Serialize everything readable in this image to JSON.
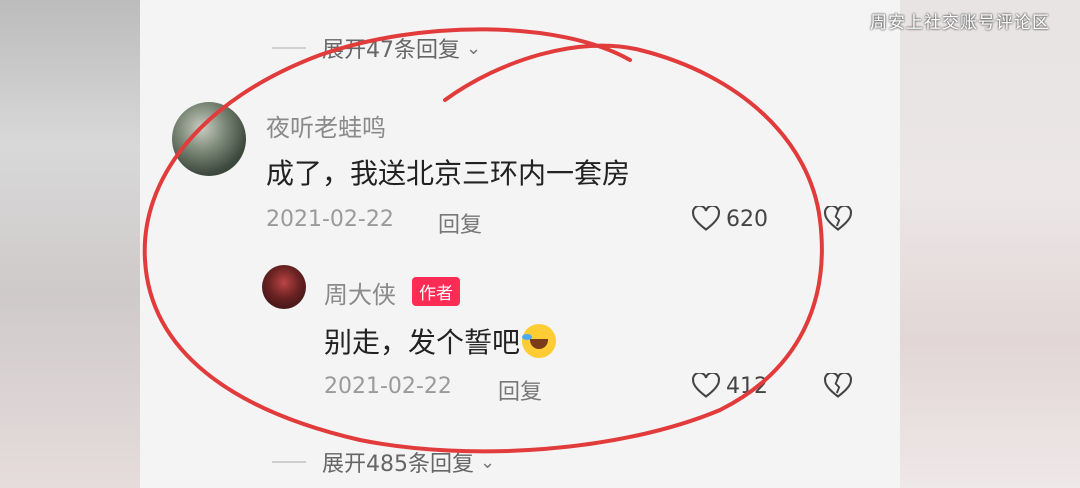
{
  "watermark": "周安上社交账号评论区",
  "expand_top": "展开47条回复",
  "expand_bottom": "展开485条回复",
  "comment1": {
    "username": "夜听老蛙鸣",
    "text": "成了，我送北京三环内一套房",
    "date": "2021-02-22",
    "reply_label": "回复",
    "likes": "620"
  },
  "comment2": {
    "username": "周大侠",
    "badge": "作者",
    "text": "别走，发个誓吧",
    "emoji": "laughing-tears-emoji",
    "date": "2021-02-22",
    "reply_label": "回复",
    "likes": "412"
  },
  "colors": {
    "annotation_circle": "#e23b3b",
    "author_badge": "#fe2c55"
  }
}
